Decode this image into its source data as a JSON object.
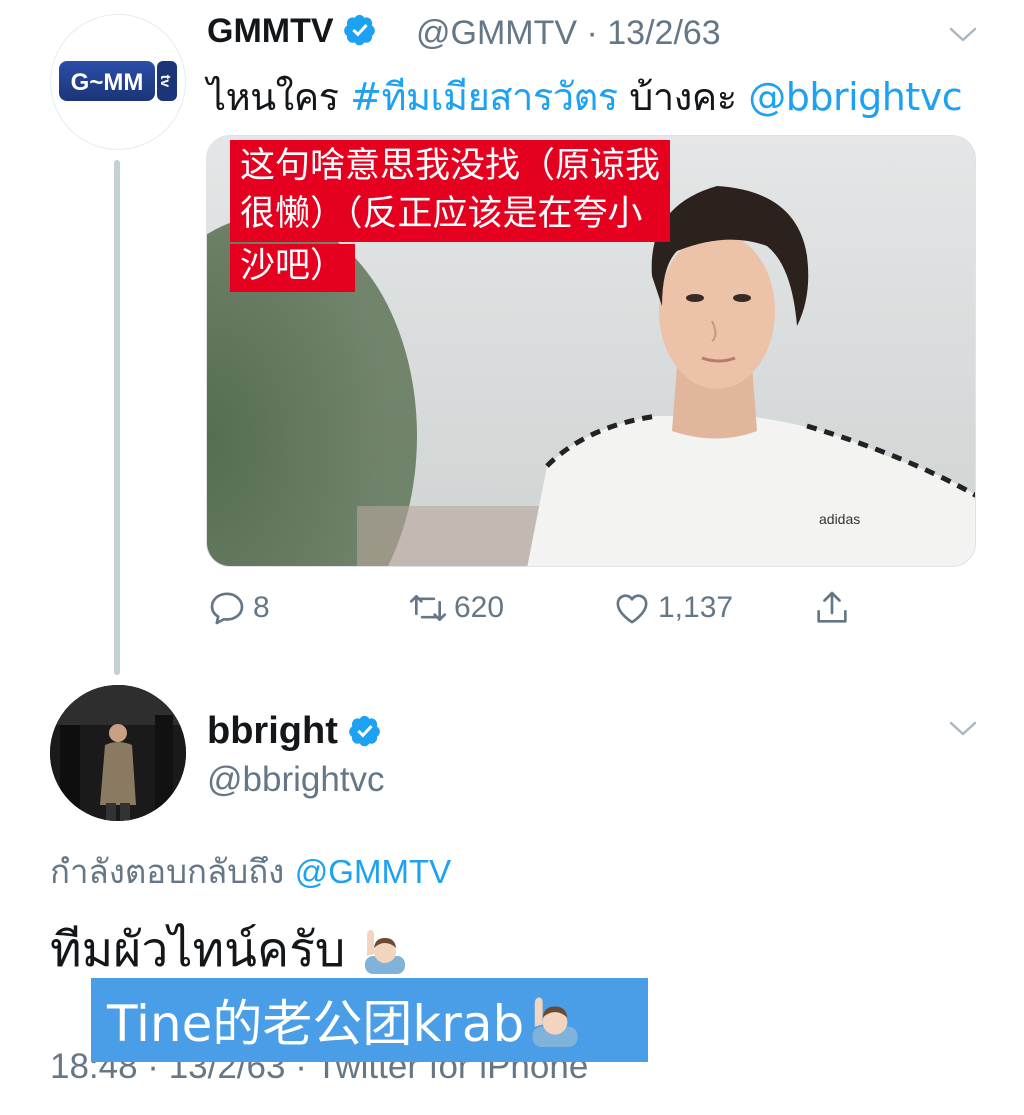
{
  "tweet1": {
    "name": "GMMTV",
    "handle_time": "@GMMTV · 13/2/63",
    "text_plain": "ไหนใคร ",
    "hashtag": "#ทีมเมียสารวัตร",
    "text_mid": " บ้างคะ ",
    "mention": "@bbrightvc",
    "avatar_logo_text": "G~MM",
    "avatar_logo_side": "tv",
    "translation_overlay": {
      "line1": "这句啥意思我没找（原谅我",
      "line2": "很懒）（反正应该是在夸小",
      "line3": "沙吧）"
    },
    "actions": {
      "reply_count": "8",
      "retweet_count": "620",
      "like_count": "1,137"
    }
  },
  "tweet2": {
    "name": "bbright",
    "handle": "@bbrightvc",
    "reply_prefix": "กำลังตอบกลับถึง ",
    "reply_mention": "@GMMTV",
    "text": "ทีมผัวไทน์ครับ",
    "translation_overlay": "Tine的老公团krab",
    "timestamp": "18:48 · 13/2/63 · Twitter for iPhone"
  },
  "colors": {
    "link": "#1da1f2",
    "secondary_text": "#657786",
    "overlay_red": "#e6001f",
    "overlay_blue": "#4a9ee8",
    "verified": "#1da1f2"
  },
  "icons": [
    "verified-badge-icon",
    "chevron-down-icon",
    "reply-icon",
    "retweet-icon",
    "like-icon",
    "share-icon",
    "raising-hand-emoji-icon"
  ]
}
